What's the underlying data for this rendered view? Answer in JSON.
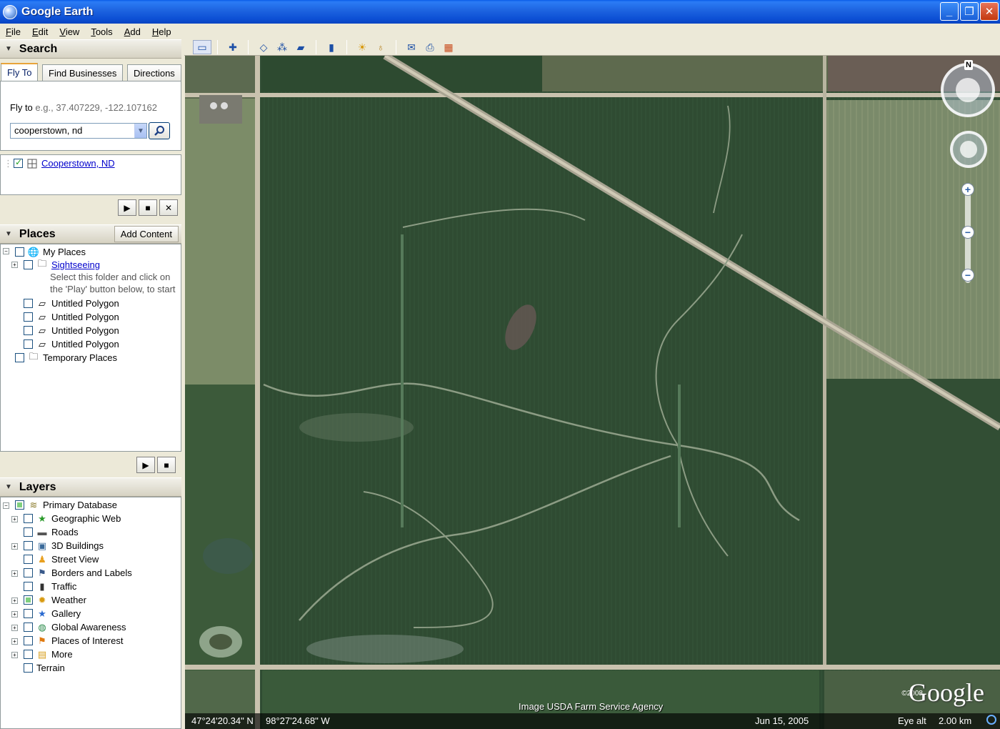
{
  "window": {
    "title": "Google Earth",
    "controls": [
      "_",
      "❐",
      "✕"
    ]
  },
  "menu": [
    {
      "key": "F",
      "rest": "ile"
    },
    {
      "key": "E",
      "rest": "dit"
    },
    {
      "key": "V",
      "rest": "iew"
    },
    {
      "key": "T",
      "rest": "ools"
    },
    {
      "key": "A",
      "rest": "dd"
    },
    {
      "key": "H",
      "rest": "elp"
    }
  ],
  "search": {
    "title": "Search",
    "tabs": [
      "Fly To",
      "Find Businesses",
      "Directions"
    ],
    "fly_label": "Fly to",
    "fly_hint": "e.g., 37.407229, -122.107162",
    "query": "cooperstown, nd",
    "result": "Cooperstown, ND"
  },
  "places": {
    "title": "Places",
    "add_content": "Add Content",
    "items": [
      {
        "label": "My Places",
        "icon": "globe-icon"
      },
      {
        "label": "Sightseeing",
        "icon": "folder-icon",
        "link": true
      },
      {
        "label": "Untitled Polygon",
        "icon": "polygon-icon"
      },
      {
        "label": "Untitled Polygon",
        "icon": "polygon-icon"
      },
      {
        "label": "Untitled Polygon",
        "icon": "polygon-icon"
      },
      {
        "label": "Untitled Polygon",
        "icon": "polygon-icon"
      },
      {
        "label": "Temporary Places",
        "icon": "folder-icon"
      }
    ],
    "note_line1": "Select this folder and click on",
    "note_line2": "the 'Play' button below, to start"
  },
  "layers": {
    "title": "Layers",
    "items": [
      {
        "label": "Primary Database",
        "icon": "database-icon"
      },
      {
        "label": "Geographic Web",
        "icon": "star-icon"
      },
      {
        "label": "Roads",
        "icon": "road-icon"
      },
      {
        "label": "3D Buildings",
        "icon": "building-icon"
      },
      {
        "label": "Street View",
        "icon": "person-icon"
      },
      {
        "label": "Borders and Labels",
        "icon": "flag-icon"
      },
      {
        "label": "Traffic",
        "icon": "traffic-light-icon"
      },
      {
        "label": "Weather",
        "icon": "sun-icon"
      },
      {
        "label": "Gallery",
        "icon": "star-icon"
      },
      {
        "label": "Global Awareness",
        "icon": "globe-icon"
      },
      {
        "label": "Places of Interest",
        "icon": "flag-icon"
      },
      {
        "label": "More",
        "icon": "note-icon"
      },
      {
        "label": "Terrain",
        "icon": ""
      }
    ]
  },
  "toolbar": [
    "sidebar-icon",
    "placemark-icon",
    "polygon-icon",
    "path-icon",
    "overlay-icon",
    "ruler-icon",
    "sun-icon",
    "planet-icon",
    "email-icon",
    "print-icon",
    "maps-icon"
  ],
  "map": {
    "lat": "47°24'20.34\" N",
    "lon": "98°27'24.68\" W",
    "date": "Jun 15, 2005",
    "eye_alt_label": "Eye alt",
    "eye_alt": "2.00 km",
    "attribution": "Image USDA Farm Service Agency",
    "logo": "Google",
    "copyright": "©2008",
    "north": "N"
  },
  "colors": {
    "titlebar": "#0c4fd4",
    "field": "#2e4a30",
    "road": "#c9c2ae",
    "link": "#0000cc"
  }
}
